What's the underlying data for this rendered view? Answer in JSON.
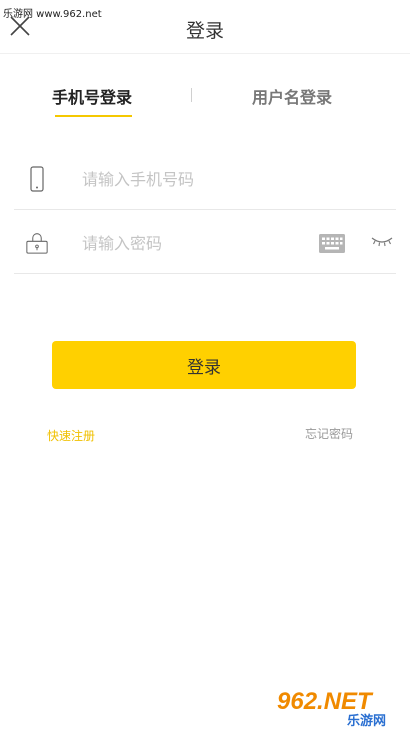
{
  "watermark": {
    "site": "乐游网 www.962.net",
    "logo_main": "962.NET",
    "logo_sub": "乐游网"
  },
  "header": {
    "title": "登录"
  },
  "tabs": [
    {
      "label": "手机号登录",
      "active": true
    },
    {
      "label": "用户名登录",
      "active": false
    }
  ],
  "phone": {
    "placeholder": "请输入手机号码",
    "value": ""
  },
  "password": {
    "placeholder": "请输入密码",
    "value": ""
  },
  "login_button": {
    "label": "登录"
  },
  "links": {
    "register": "快速注册",
    "forgot": "忘记密码"
  },
  "colors": {
    "accent": "#ffd000",
    "register_link": "#f0c000"
  }
}
